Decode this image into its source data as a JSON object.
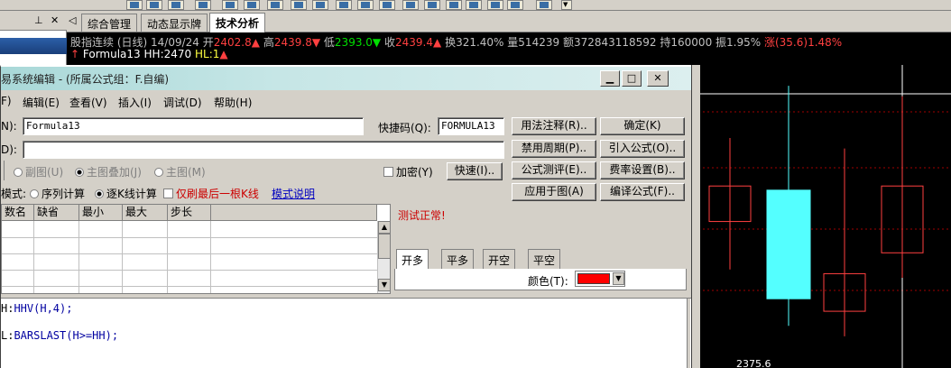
{
  "tabs": {
    "items": [
      {
        "label": "综合管理"
      },
      {
        "label": "动态显示牌"
      },
      {
        "label": "技术分析"
      }
    ]
  },
  "quote": {
    "name": "股指连续 (日线)",
    "date": "14/09/24",
    "open_label": "开",
    "open": "2402.8",
    "high_label": "高",
    "high": "2439.8",
    "low_label": "低",
    "low": "2393.0",
    "close_label": "收",
    "close": "2439.4",
    "turnover": "换321.40%",
    "volume": "量514239",
    "amount": "额372843118592",
    "position": "持160000",
    "amplitude": "振1.95%",
    "change": "涨(35.6)1.48%"
  },
  "indicator": {
    "name": "Formula13",
    "hh": "HH:2470",
    "hl": "HL:1"
  },
  "chart_data": {
    "type": "candlestick",
    "price_label": "2375.6",
    "candles": [
      {
        "open": 2435,
        "close": 2452,
        "high": 2475,
        "low": 2412,
        "color": "#ff4040"
      },
      {
        "open": 2450,
        "close": 2398,
        "high": 2500,
        "low": 2385,
        "color": "#54ffff"
      },
      {
        "open": 2392,
        "close": 2410,
        "high": 2470,
        "low": 2380,
        "color": "#ff4040"
      },
      {
        "open": 2420,
        "close": 2452,
        "high": 2495,
        "low": 2408,
        "color": "#ff4040"
      }
    ],
    "ylim": [
      2370,
      2510
    ]
  },
  "dialog": {
    "title": "易系统编辑 - (所属公式组：F.自编)",
    "min_icon": "minimize-icon",
    "max_icon": "maximize-icon",
    "close_icon": "close-icon",
    "menu": [
      {
        "label": "F)"
      },
      {
        "label": "编辑(E)"
      },
      {
        "label": "查看(V)"
      },
      {
        "label": "插入(I)"
      },
      {
        "label": "调试(D)"
      },
      {
        "label": "帮助(H)"
      }
    ],
    "name_label": "N):",
    "name_value": "Formula13",
    "shortcut_label": "快捷码(Q):",
    "shortcut_value": "FORMULA13",
    "desc_label": "D):",
    "desc_value": "",
    "radio_sub": "副图(U)",
    "radio_main_overlay": "主图叠加(J)",
    "radio_main": "主图(M)",
    "encrypt_label": "加密(Y)",
    "quick_button": "快速(I)..",
    "mode_label": "模式:",
    "mode_seq": "序列计算",
    "mode_kline": "逐K线计算",
    "last_bar_only": "仅刷最后一根K线",
    "mode_help": "模式说明",
    "buttons": {
      "usage": "用法注释(R)..",
      "ok": "确定(K)",
      "forbid_period": "禁用周期(P)..",
      "import": "引入公式(O)..",
      "test": "公式测评(E)..",
      "fee": "费率设置(B)..",
      "apply": "应用于图(A)",
      "compile": "编译公式(F).."
    },
    "param_headers": [
      "数名",
      "缺省",
      "最小",
      "最大",
      "步长"
    ],
    "status": "测试正常!",
    "signal_tabs": [
      "开多",
      "平多",
      "开空",
      "平空"
    ],
    "color_label": "颜色(T):",
    "code_lines": [
      {
        "name": "H:",
        "expr": "HHV(H,4);"
      },
      {
        "name": "L:",
        "expr": "BARSLAST(H>=HH);"
      }
    ]
  }
}
